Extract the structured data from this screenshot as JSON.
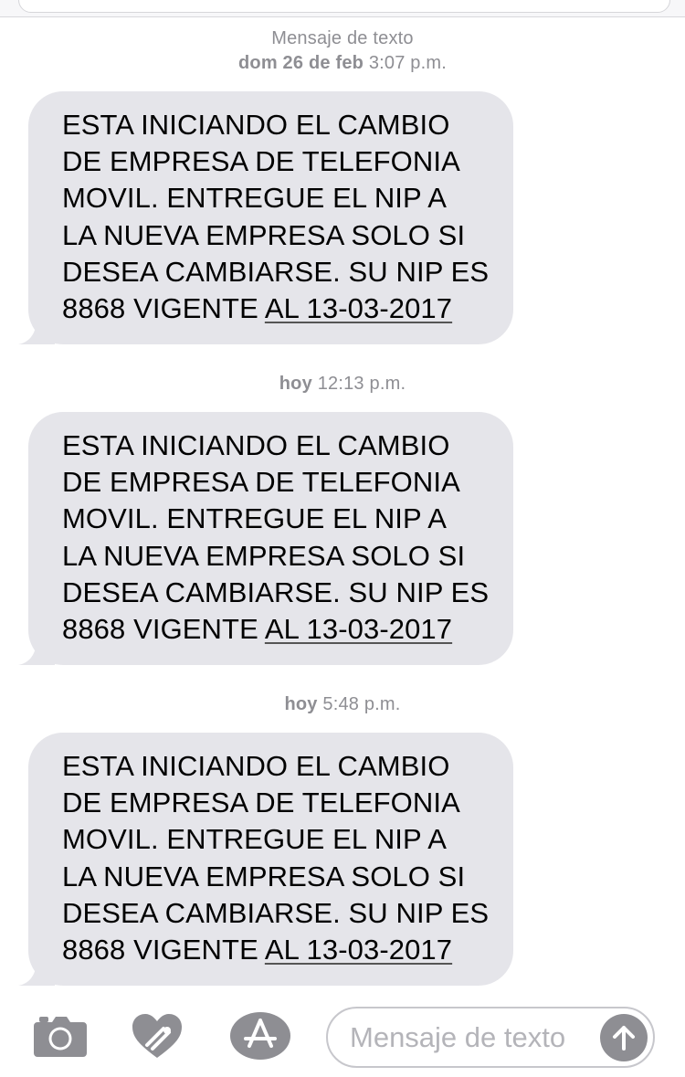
{
  "conversation": {
    "service_label": "Mensaje de texto",
    "messages": [
      {
        "day": "dom 26 de feb",
        "time": "3:07 p.m.",
        "lines": [
          "ESTA INICIANDO EL CAMBIO",
          "DE EMPRESA DE TELEFONIA",
          "MOVIL. ENTREGUE EL NIP A",
          "LA NUEVA EMPRESA SOLO SI",
          "DESEA CAMBIARSE. SU NIP ES"
        ],
        "last_line_prefix": "8868 VIGENTE ",
        "last_line_link": "AL 13-03-2017"
      },
      {
        "day": "hoy",
        "time": "12:13 p.m.",
        "lines": [
          "ESTA INICIANDO EL CAMBIO",
          "DE EMPRESA DE TELEFONIA",
          "MOVIL. ENTREGUE EL NIP A",
          "LA NUEVA EMPRESA SOLO SI",
          "DESEA CAMBIARSE. SU NIP ES"
        ],
        "last_line_prefix": "8868 VIGENTE ",
        "last_line_link": "AL 13-03-2017"
      },
      {
        "day": "hoy",
        "time": "5:48 p.m.",
        "lines": [
          "ESTA INICIANDO EL CAMBIO",
          "DE EMPRESA DE TELEFONIA",
          "MOVIL. ENTREGUE EL NIP A",
          "LA NUEVA EMPRESA SOLO SI",
          "DESEA CAMBIARSE. SU NIP ES"
        ],
        "last_line_prefix": "8868 VIGENTE ",
        "last_line_link": "AL 13-03-2017"
      }
    ]
  },
  "input_bar": {
    "placeholder": "Mensaje de texto",
    "icons": [
      "camera-icon",
      "digital-touch-heart-icon",
      "app-store-icon",
      "send-arrow-icon"
    ]
  },
  "colors": {
    "bubble_received": "#e5e5ea",
    "meta_text": "#8e8e93",
    "send_button": "#8e8e93",
    "icon_gray": "#8e8e93"
  }
}
